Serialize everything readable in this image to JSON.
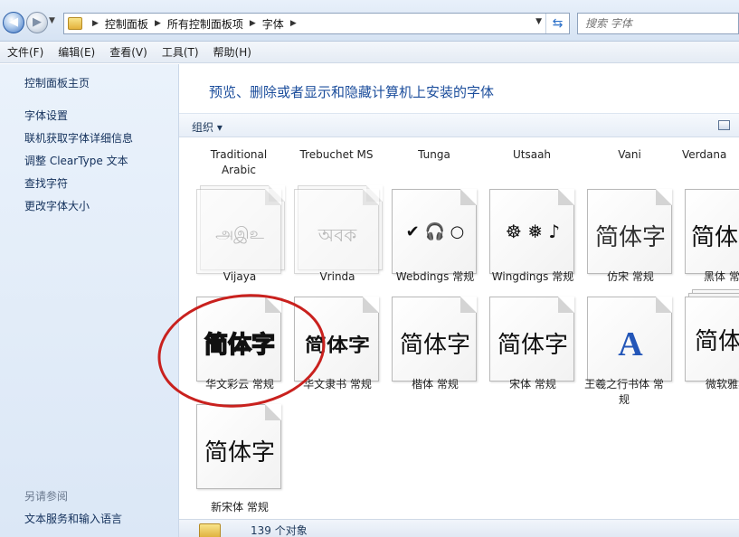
{
  "address": {
    "crumbs": [
      "控制面板",
      "所有控制面板项",
      "字体"
    ],
    "search_placeholder": "搜索 字体"
  },
  "menu": [
    "文件(F)",
    "编辑(E)",
    "查看(V)",
    "工具(T)",
    "帮助(H)"
  ],
  "leftpane": {
    "links": [
      "控制面板主页",
      "字体设置",
      "联机获取字体详细信息",
      "调整 ClearType 文本",
      "查找字符",
      "更改字体大小"
    ],
    "see_also": "另请参阅",
    "see_also_links": [
      "文本服务和输入语言"
    ]
  },
  "main": {
    "heading": "预览、删除或者显示和隐藏计算机上安装的字体",
    "organize": "组织",
    "top_names": [
      "Traditional Arabic",
      "Trebuchet MS",
      "Tunga",
      "Utsaah",
      "Vani",
      "Verdana"
    ],
    "row1": [
      {
        "label": "Vijaya",
        "glyph": "அஇஉ",
        "faded": true
      },
      {
        "label": "Vrinda",
        "glyph": "অবক",
        "faded": true
      },
      {
        "label": "Webdings 常规",
        "glyph": "✔ 🎧 ○",
        "faded": false
      },
      {
        "label": "Wingdings 常规",
        "glyph": "☸ ❅ ♪",
        "faded": false
      },
      {
        "label": "仿宋 常规",
        "glyph": "简体字",
        "faded": false
      },
      {
        "label": "黑体 常规",
        "glyph": "简体",
        "faded": false
      }
    ],
    "row2": [
      {
        "label": "华文彩云 常规",
        "glyph": "简体字"
      },
      {
        "label": "华文隶书 常规",
        "glyph": "简体字"
      },
      {
        "label": "楷体 常规",
        "glyph": "简体字"
      },
      {
        "label": "宋体 常规",
        "glyph": "简体字"
      },
      {
        "label": "王羲之行书体 常规",
        "glyph": "A"
      },
      {
        "label": "微软雅黑",
        "glyph": "简体"
      }
    ],
    "row3": [
      {
        "label": "新宋体 常规",
        "glyph": "简体字"
      }
    ],
    "status_count": "139 个对象"
  },
  "colors": {
    "heading": "#1c4e9c",
    "annotation_circle": "#c9211e"
  }
}
